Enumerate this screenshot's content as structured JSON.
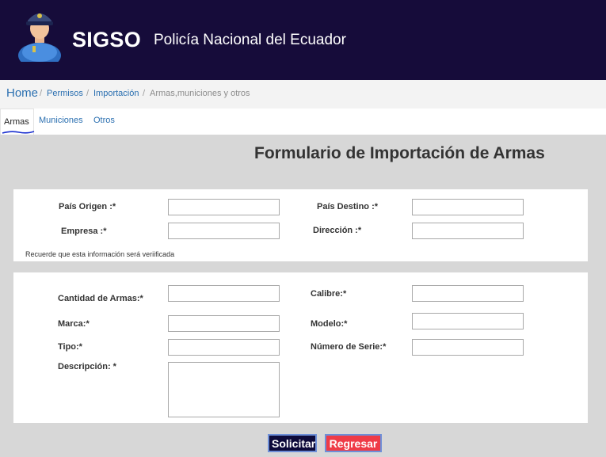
{
  "header": {
    "brand": "SIGSO",
    "subtitle": "Policía Nacional del Ecuador"
  },
  "breadcrumb": {
    "home": "Home",
    "separator": "/",
    "items": [
      "Permisos",
      "Importación"
    ],
    "current": "Armas,municiones y otros"
  },
  "tabs": [
    {
      "label": "Armas",
      "active": true
    },
    {
      "label": "Municiones",
      "active": false
    },
    {
      "label": "Otros",
      "active": false
    }
  ],
  "form": {
    "title": "Formulario de Importación de Armas",
    "section1": {
      "pais_origen_label": "País Origen :*",
      "pais_destino_label": "País Destino :*",
      "empresa_label": "Empresa :*",
      "direccion_label": "Dirección :*",
      "note": "Recuerde que esta información será veriificada"
    },
    "section2": {
      "cantidad_label": "Cantidad de Armas:*",
      "calibre_label": "Calibre:*",
      "marca_label": "Marca:*",
      "modelo_label": "Modelo:*",
      "tipo_label": "Tipo:*",
      "numero_serie_label": "Número de Serie:*",
      "descripcion_label": "Descripción: *"
    },
    "values": {
      "pais_origen": "",
      "pais_destino": "",
      "empresa": "",
      "direccion": "",
      "cantidad": "",
      "calibre": "",
      "marca": "",
      "modelo": "",
      "tipo": "",
      "numero_serie": "",
      "descripcion": ""
    }
  },
  "buttons": {
    "solicitar": "Solicitar",
    "regresar": "Regresar"
  },
  "colors": {
    "header_bg": "#160c3a",
    "link": "#2a6fb0",
    "page_bg": "#d7d7d7",
    "solicitar_bg": "#0d0a3a",
    "regresar_bg": "#ef3b47"
  },
  "icons": {
    "avatar": "police-officer-icon"
  }
}
